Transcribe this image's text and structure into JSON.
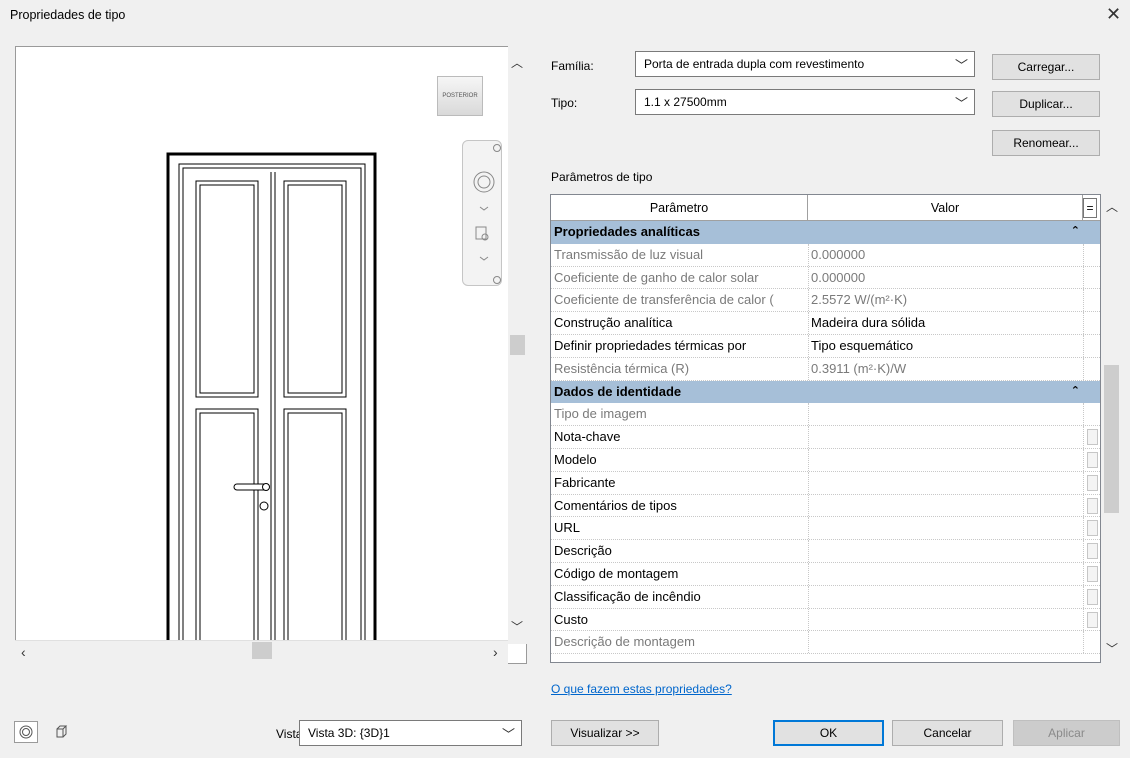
{
  "dialog": {
    "title": "Propriedades de tipo"
  },
  "preview": {
    "viewcube_label": "POSTERIOR",
    "view_label": "Vista:",
    "view_value": "Vista 3D: {3D}1"
  },
  "family": {
    "label": "Família:",
    "value": "Porta de entrada dupla com revestimento"
  },
  "type": {
    "label": "Tipo:",
    "value": "1.1 x 27500mm"
  },
  "buttons": {
    "load": "Carregar...",
    "duplicate": "Duplicar...",
    "rename": "Renomear...",
    "preview": "Visualizar >>",
    "ok": "OK",
    "cancel": "Cancelar",
    "apply": "Aplicar"
  },
  "params": {
    "section_label": "Parâmetros de tipo",
    "col_param": "Parâmetro",
    "col_value": "Valor",
    "col_eq": "=",
    "rows": [
      {
        "kind": "group",
        "name": "Propriedades analíticas",
        "toggle": "⌃"
      },
      {
        "kind": "gray",
        "name": "Transmissão de luz visual",
        "value": "0.000000"
      },
      {
        "kind": "gray",
        "name": "Coeficiente de ganho de calor solar",
        "value": "0.000000"
      },
      {
        "kind": "gray",
        "name": "Coeficiente de transferência de calor (",
        "value": "2.5572 W/(m²·K)"
      },
      {
        "kind": "normal",
        "name": "Construção analítica",
        "value": "Madeira dura sólida"
      },
      {
        "kind": "normal",
        "name": "Definir propriedades térmicas por",
        "value": "Tipo esquemático"
      },
      {
        "kind": "gray",
        "name": "Resistência térmica (R)",
        "value": "0.3911 (m²·K)/W"
      },
      {
        "kind": "group",
        "name": "Dados de identidade",
        "toggle": "⌃"
      },
      {
        "kind": "gray",
        "name": "Tipo de imagem",
        "value": ""
      },
      {
        "kind": "edit",
        "name": "Nota-chave",
        "value": ""
      },
      {
        "kind": "edit",
        "name": "Modelo",
        "value": ""
      },
      {
        "kind": "edit",
        "name": "Fabricante",
        "value": ""
      },
      {
        "kind": "edit",
        "name": "Comentários de tipos",
        "value": ""
      },
      {
        "kind": "edit",
        "name": "URL",
        "value": ""
      },
      {
        "kind": "edit",
        "name": "Descrição",
        "value": ""
      },
      {
        "kind": "edit",
        "name": "Código de montagem",
        "value": ""
      },
      {
        "kind": "edit",
        "name": "Classificação de incêndio",
        "value": ""
      },
      {
        "kind": "edit",
        "name": "Custo",
        "value": ""
      },
      {
        "kind": "gray",
        "name": "Descrição de montagem",
        "value": ""
      }
    ]
  },
  "help_link": "O que fazem estas propriedades?",
  "icons": {
    "close": "close-icon",
    "steering_wheel": "steering-wheel-icon",
    "zoom": "zoom-region-icon",
    "scroll_up": "chevron-up-icon",
    "scroll_down": "chevron-down-icon",
    "scroll_left": "chevron-left-icon",
    "scroll_right": "chevron-right-icon"
  }
}
